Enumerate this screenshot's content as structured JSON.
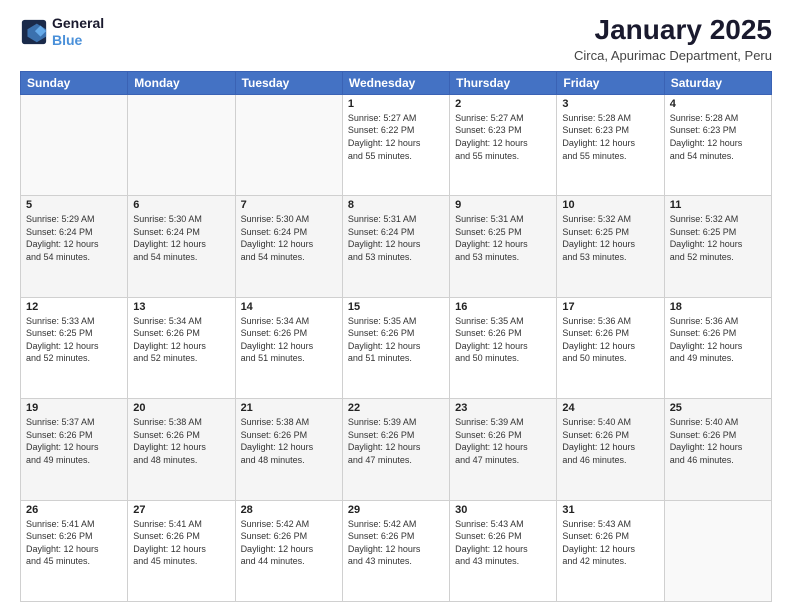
{
  "logo": {
    "line1": "General",
    "line2": "Blue"
  },
  "title": "January 2025",
  "subtitle": "Circa, Apurimac Department, Peru",
  "headers": [
    "Sunday",
    "Monday",
    "Tuesday",
    "Wednesday",
    "Thursday",
    "Friday",
    "Saturday"
  ],
  "weeks": [
    [
      {
        "day": "",
        "info": ""
      },
      {
        "day": "",
        "info": ""
      },
      {
        "day": "",
        "info": ""
      },
      {
        "day": "1",
        "info": "Sunrise: 5:27 AM\nSunset: 6:22 PM\nDaylight: 12 hours\nand 55 minutes."
      },
      {
        "day": "2",
        "info": "Sunrise: 5:27 AM\nSunset: 6:23 PM\nDaylight: 12 hours\nand 55 minutes."
      },
      {
        "day": "3",
        "info": "Sunrise: 5:28 AM\nSunset: 6:23 PM\nDaylight: 12 hours\nand 55 minutes."
      },
      {
        "day": "4",
        "info": "Sunrise: 5:28 AM\nSunset: 6:23 PM\nDaylight: 12 hours\nand 54 minutes."
      }
    ],
    [
      {
        "day": "5",
        "info": "Sunrise: 5:29 AM\nSunset: 6:24 PM\nDaylight: 12 hours\nand 54 minutes."
      },
      {
        "day": "6",
        "info": "Sunrise: 5:30 AM\nSunset: 6:24 PM\nDaylight: 12 hours\nand 54 minutes."
      },
      {
        "day": "7",
        "info": "Sunrise: 5:30 AM\nSunset: 6:24 PM\nDaylight: 12 hours\nand 54 minutes."
      },
      {
        "day": "8",
        "info": "Sunrise: 5:31 AM\nSunset: 6:24 PM\nDaylight: 12 hours\nand 53 minutes."
      },
      {
        "day": "9",
        "info": "Sunrise: 5:31 AM\nSunset: 6:25 PM\nDaylight: 12 hours\nand 53 minutes."
      },
      {
        "day": "10",
        "info": "Sunrise: 5:32 AM\nSunset: 6:25 PM\nDaylight: 12 hours\nand 53 minutes."
      },
      {
        "day": "11",
        "info": "Sunrise: 5:32 AM\nSunset: 6:25 PM\nDaylight: 12 hours\nand 52 minutes."
      }
    ],
    [
      {
        "day": "12",
        "info": "Sunrise: 5:33 AM\nSunset: 6:25 PM\nDaylight: 12 hours\nand 52 minutes."
      },
      {
        "day": "13",
        "info": "Sunrise: 5:34 AM\nSunset: 6:26 PM\nDaylight: 12 hours\nand 52 minutes."
      },
      {
        "day": "14",
        "info": "Sunrise: 5:34 AM\nSunset: 6:26 PM\nDaylight: 12 hours\nand 51 minutes."
      },
      {
        "day": "15",
        "info": "Sunrise: 5:35 AM\nSunset: 6:26 PM\nDaylight: 12 hours\nand 51 minutes."
      },
      {
        "day": "16",
        "info": "Sunrise: 5:35 AM\nSunset: 6:26 PM\nDaylight: 12 hours\nand 50 minutes."
      },
      {
        "day": "17",
        "info": "Sunrise: 5:36 AM\nSunset: 6:26 PM\nDaylight: 12 hours\nand 50 minutes."
      },
      {
        "day": "18",
        "info": "Sunrise: 5:36 AM\nSunset: 6:26 PM\nDaylight: 12 hours\nand 49 minutes."
      }
    ],
    [
      {
        "day": "19",
        "info": "Sunrise: 5:37 AM\nSunset: 6:26 PM\nDaylight: 12 hours\nand 49 minutes."
      },
      {
        "day": "20",
        "info": "Sunrise: 5:38 AM\nSunset: 6:26 PM\nDaylight: 12 hours\nand 48 minutes."
      },
      {
        "day": "21",
        "info": "Sunrise: 5:38 AM\nSunset: 6:26 PM\nDaylight: 12 hours\nand 48 minutes."
      },
      {
        "day": "22",
        "info": "Sunrise: 5:39 AM\nSunset: 6:26 PM\nDaylight: 12 hours\nand 47 minutes."
      },
      {
        "day": "23",
        "info": "Sunrise: 5:39 AM\nSunset: 6:26 PM\nDaylight: 12 hours\nand 47 minutes."
      },
      {
        "day": "24",
        "info": "Sunrise: 5:40 AM\nSunset: 6:26 PM\nDaylight: 12 hours\nand 46 minutes."
      },
      {
        "day": "25",
        "info": "Sunrise: 5:40 AM\nSunset: 6:26 PM\nDaylight: 12 hours\nand 46 minutes."
      }
    ],
    [
      {
        "day": "26",
        "info": "Sunrise: 5:41 AM\nSunset: 6:26 PM\nDaylight: 12 hours\nand 45 minutes."
      },
      {
        "day": "27",
        "info": "Sunrise: 5:41 AM\nSunset: 6:26 PM\nDaylight: 12 hours\nand 45 minutes."
      },
      {
        "day": "28",
        "info": "Sunrise: 5:42 AM\nSunset: 6:26 PM\nDaylight: 12 hours\nand 44 minutes."
      },
      {
        "day": "29",
        "info": "Sunrise: 5:42 AM\nSunset: 6:26 PM\nDaylight: 12 hours\nand 43 minutes."
      },
      {
        "day": "30",
        "info": "Sunrise: 5:43 AM\nSunset: 6:26 PM\nDaylight: 12 hours\nand 43 minutes."
      },
      {
        "day": "31",
        "info": "Sunrise: 5:43 AM\nSunset: 6:26 PM\nDaylight: 12 hours\nand 42 minutes."
      },
      {
        "day": "",
        "info": ""
      }
    ]
  ]
}
